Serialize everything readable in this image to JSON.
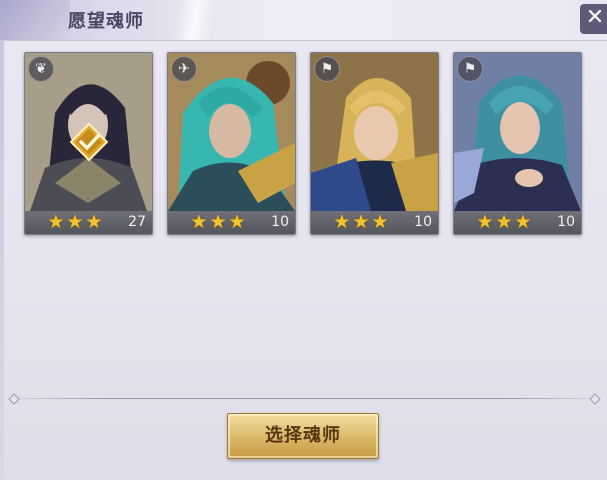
{
  "header": {
    "title": "愿望魂师",
    "close_symbol": "✕"
  },
  "cards": [
    {
      "level": "27",
      "stars": "★★★",
      "faction_icon": "wing-icon",
      "selected": true,
      "hair": "#2a2747",
      "bg": "#b8a582"
    },
    {
      "level": "10",
      "stars": "★★★",
      "faction_icon": "dove-icon",
      "selected": false,
      "hair": "#38b6b0",
      "bg": "#a58a5c"
    },
    {
      "level": "10",
      "stars": "★★★",
      "faction_icon": "banner-icon",
      "selected": false,
      "hair": "#d9b35a",
      "bg": "#8d7448"
    },
    {
      "level": "10",
      "stars": "★★★",
      "faction_icon": "banner-icon",
      "selected": false,
      "hair": "#3f8fa3",
      "bg": "#6f7fa6"
    }
  ],
  "button": {
    "label": "选择魂师"
  },
  "colors": {
    "star": "#f4c22d",
    "button_gold": "#d9b766",
    "accent": "#5d5b78"
  }
}
